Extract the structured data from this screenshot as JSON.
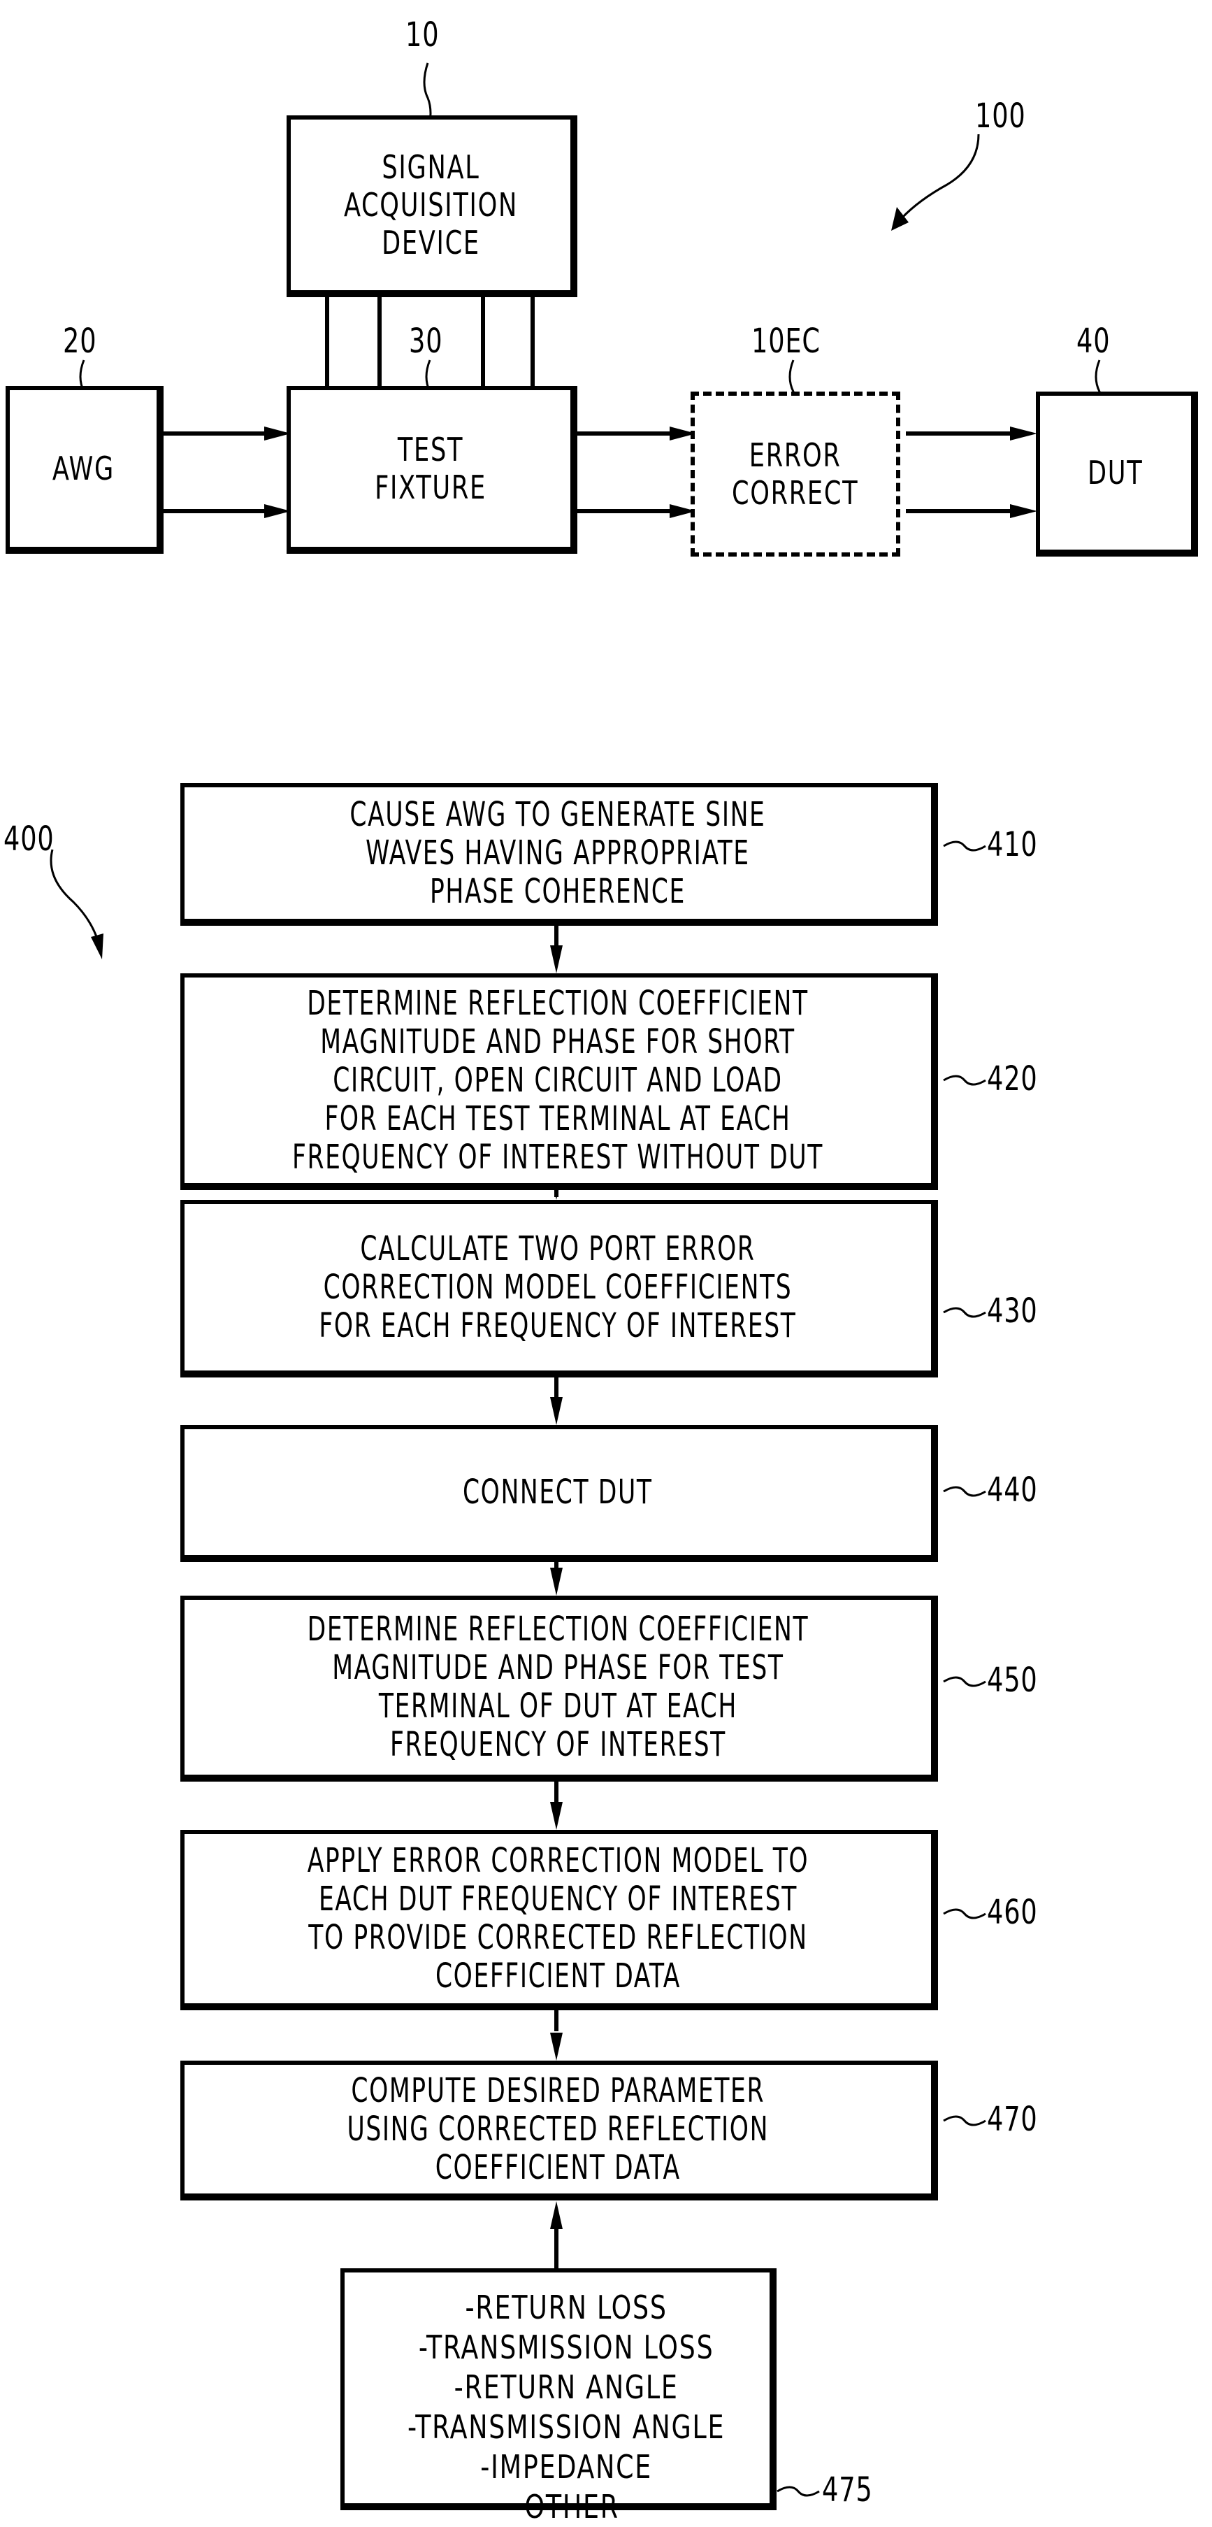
{
  "figure_top": {
    "ref_label": "100",
    "blocks": {
      "signal_acquisition": {
        "ref": "10",
        "text": "SIGNAL\nACQUISITION\nDEVICE"
      },
      "awg": {
        "ref": "20",
        "text": "AWG"
      },
      "test_fixture": {
        "ref": "30",
        "text": "TEST\nFIXTURE"
      },
      "error_correct": {
        "ref": "10EC",
        "text": "ERROR\nCORRECT"
      },
      "dut": {
        "ref": "40",
        "text": "DUT"
      }
    }
  },
  "figure_bottom": {
    "ref_label": "400",
    "steps": [
      {
        "ref": "410",
        "text": "CAUSE AWG TO GENERATE SINE\nWAVES HAVING APPROPRIATE\nPHASE COHERENCE"
      },
      {
        "ref": "420",
        "text": "DETERMINE REFLECTION COEFFICIENT\nMAGNITUDE AND PHASE FOR SHORT\nCIRCUIT, OPEN CIRCUIT AND LOAD\nFOR EACH TEST TERMINAL AT EACH\nFREQUENCY OF INTEREST WITHOUT DUT"
      },
      {
        "ref": "430",
        "text": "CALCULATE TWO PORT ERROR\nCORRECTION MODEL COEFFICIENTS\nFOR EACH FREQUENCY OF INTEREST"
      },
      {
        "ref": "440",
        "text": "CONNECT DUT"
      },
      {
        "ref": "450",
        "text": "DETERMINE REFLECTION COEFFICIENT\nMAGNITUDE AND PHASE FOR TEST\nTERMINAL OF DUT AT EACH\nFREQUENCY OF INTEREST"
      },
      {
        "ref": "460",
        "text": "APPLY ERROR CORRECTION MODEL TO\nEACH DUT FREQUENCY OF INTEREST\nTO PROVIDE CORRECTED REFLECTION\nCOEFFICIENT DATA"
      },
      {
        "ref": "470",
        "text": "COMPUTE DESIRED PARAMETER\nUSING CORRECTED REFLECTION\nCOEFFICIENT DATA"
      }
    ],
    "parameters": {
      "ref": "475",
      "items": [
        "-RETURN LOSS",
        "-TRANSMISSION LOSS",
        "-RETURN ANGLE",
        "-TRANSMISSION ANGLE",
        "-IMPEDANCE",
        "-OTHER"
      ]
    }
  }
}
